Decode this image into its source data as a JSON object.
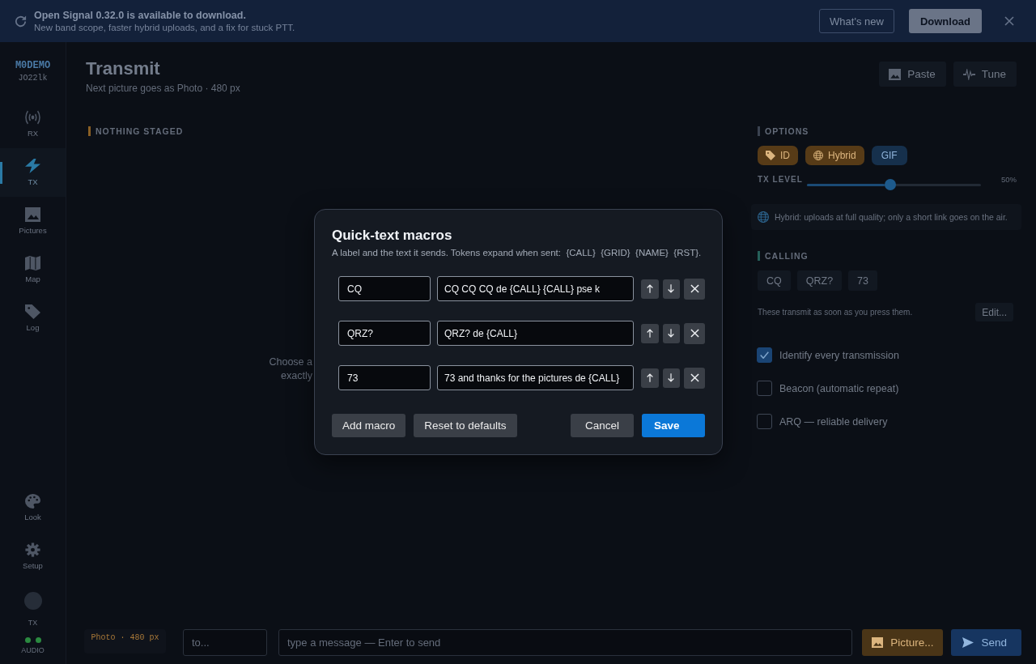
{
  "update_banner": {
    "title": "Open Signal 0.32.0 is available to download.",
    "message": "New band scope, faster hybrid uploads, and a fix for stuck PTT.",
    "buttons": [
      {
        "label": "What's new",
        "kind": "outline"
      },
      {
        "label": "Download",
        "kind": "solid"
      }
    ]
  },
  "station": {
    "callsign": "M0DEMO",
    "locator": "JO22lk"
  },
  "sidebar": {
    "items": [
      {
        "label": "RX",
        "selected": false
      },
      {
        "label": "TX",
        "selected": true
      },
      {
        "label": "Pictures",
        "selected": false
      },
      {
        "label": "Map",
        "selected": false
      },
      {
        "label": "Log",
        "selected": false
      }
    ],
    "footer_items": [
      {
        "label": "Look",
        "selected": false
      },
      {
        "label": "Setup",
        "selected": false
      }
    ],
    "indicators": [
      {
        "label": "TX",
        "kind": "tx",
        "on": false
      },
      {
        "label": "AUDIO",
        "kind": "audio",
        "on": true
      }
    ]
  },
  "page": {
    "title": "Transmit",
    "subtitle": "Next picture goes as Photo · 480 px",
    "actions": [
      {
        "label": "Paste"
      },
      {
        "label": "Tune"
      }
    ]
  },
  "staging": {
    "heading": "NOTHING STAGED",
    "hint": [
      "Choose a",
      "exactly"
    ]
  },
  "options": {
    "heading": "OPTIONS",
    "chips": [
      {
        "label": "ID",
        "color": "#573b17"
      },
      {
        "label": "Hybrid",
        "color": "#573b17"
      },
      {
        "label": "GIF",
        "color": "#16304c"
      }
    ],
    "tx_level": {
      "label": "TX LEVEL",
      "level": 0.48,
      "reading": "50%"
    },
    "note": "Hybrid: uploads at full quality; only a short link goes on the air."
  },
  "calling": {
    "heading": "CALLING",
    "macros": [
      {
        "label": "CQ"
      },
      {
        "label": "QRZ?"
      },
      {
        "label": "73"
      }
    ],
    "hint": "These transmit as soon as you press them.",
    "edit_button": "Edit..."
  },
  "toggles": [
    {
      "label": "Identify every transmission",
      "checked": true
    },
    {
      "label": "Beacon (automatic repeat)",
      "checked": false
    },
    {
      "label": "ARQ — reliable delivery",
      "checked": false
    }
  ],
  "composer": {
    "format": "Photo · 480 px",
    "to_field": {
      "placeholder": "to..."
    },
    "message_field": {
      "placeholder": "type a message — Enter to send"
    },
    "buttons": [
      {
        "label": "Picture...",
        "kind": "picture"
      },
      {
        "label": "Send",
        "kind": "send"
      }
    ]
  },
  "dialog": {
    "title": "Quick-text macros",
    "description": "A label and the text it sends. Tokens expand when sent:  {CALL}  {GRID}  {NAME}  {RST}.",
    "macros": [
      {
        "label": "CQ",
        "text": "CQ CQ CQ de {CALL} {CALL} pse k"
      },
      {
        "label": "QRZ?",
        "text": "QRZ? de {CALL}"
      },
      {
        "label": "73",
        "text": "73 and thanks for the pictures de {CALL}"
      }
    ],
    "actions": [
      {
        "label": "Add macro",
        "kind": "secondary"
      },
      {
        "label": "Reset to defaults",
        "kind": "secondary"
      }
    ],
    "confirm_buttons": [
      {
        "label": "Cancel",
        "kind": "secondary"
      },
      {
        "label": "Save",
        "kind": "primary"
      }
    ]
  }
}
